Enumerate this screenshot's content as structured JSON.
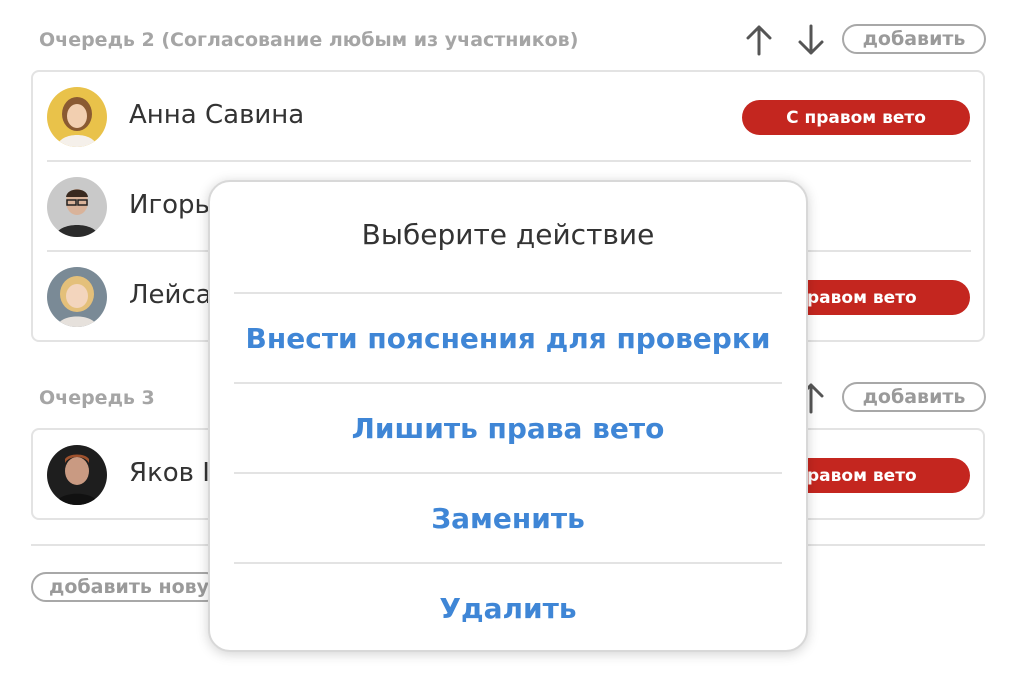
{
  "queue2": {
    "title": "Очередь 2 (Согласование любым из участников)",
    "add_label": "добавить",
    "people": [
      {
        "name": "Анна Савина",
        "badge": "С правом вето"
      },
      {
        "name": "Игорь"
      },
      {
        "name": "Лейса",
        "badge": "правом вето"
      }
    ]
  },
  "queue3": {
    "title": "Очередь 3",
    "add_label": "добавить",
    "people": [
      {
        "name": "Яков I",
        "badge": "правом вето"
      }
    ]
  },
  "add_new_label": "добавить нову",
  "modal": {
    "title": "Выберите действие",
    "actions": [
      "Внести пояснения для проверки",
      "Лишить права вето",
      "Заменить",
      "Удалить"
    ]
  },
  "colors": {
    "veto_badge": "#c4261f",
    "action_text": "#3f86d6",
    "muted_text": "#a5a5a5"
  },
  "icons": {
    "up": "arrow-up-icon",
    "down": "arrow-down-icon"
  }
}
